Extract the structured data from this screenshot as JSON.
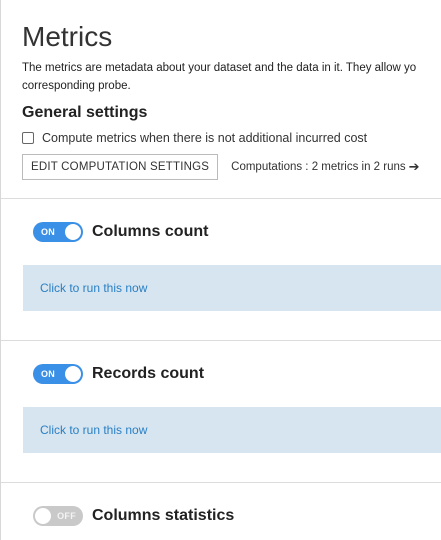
{
  "page": {
    "title": "Metrics",
    "description_line1": "The metrics are metadata about your dataset and the data in it. They allow yo",
    "description_line2": "corresponding probe."
  },
  "general_settings": {
    "title": "General settings",
    "checkbox_label": "Compute metrics when there is not additional incurred cost",
    "checkbox_checked": false,
    "edit_button": "EDIT COMPUTATION SETTINGS",
    "computations_text": "Computations : 2 metrics in 2 runs",
    "computations_arrow": "➔"
  },
  "probes": [
    {
      "name": "Columns count",
      "enabled": true,
      "toggle_label": "ON",
      "run_link": "Click to run this now"
    },
    {
      "name": "Records count",
      "enabled": true,
      "toggle_label": "ON",
      "run_link": "Click to run this now"
    },
    {
      "name": "Columns statistics",
      "enabled": false,
      "toggle_label": "OFF"
    }
  ],
  "colors": {
    "toggle_on": "#3a8fe6",
    "toggle_off": "#c9c9c9",
    "run_box_bg": "#d6e5ef",
    "link": "#2a7fc4"
  }
}
